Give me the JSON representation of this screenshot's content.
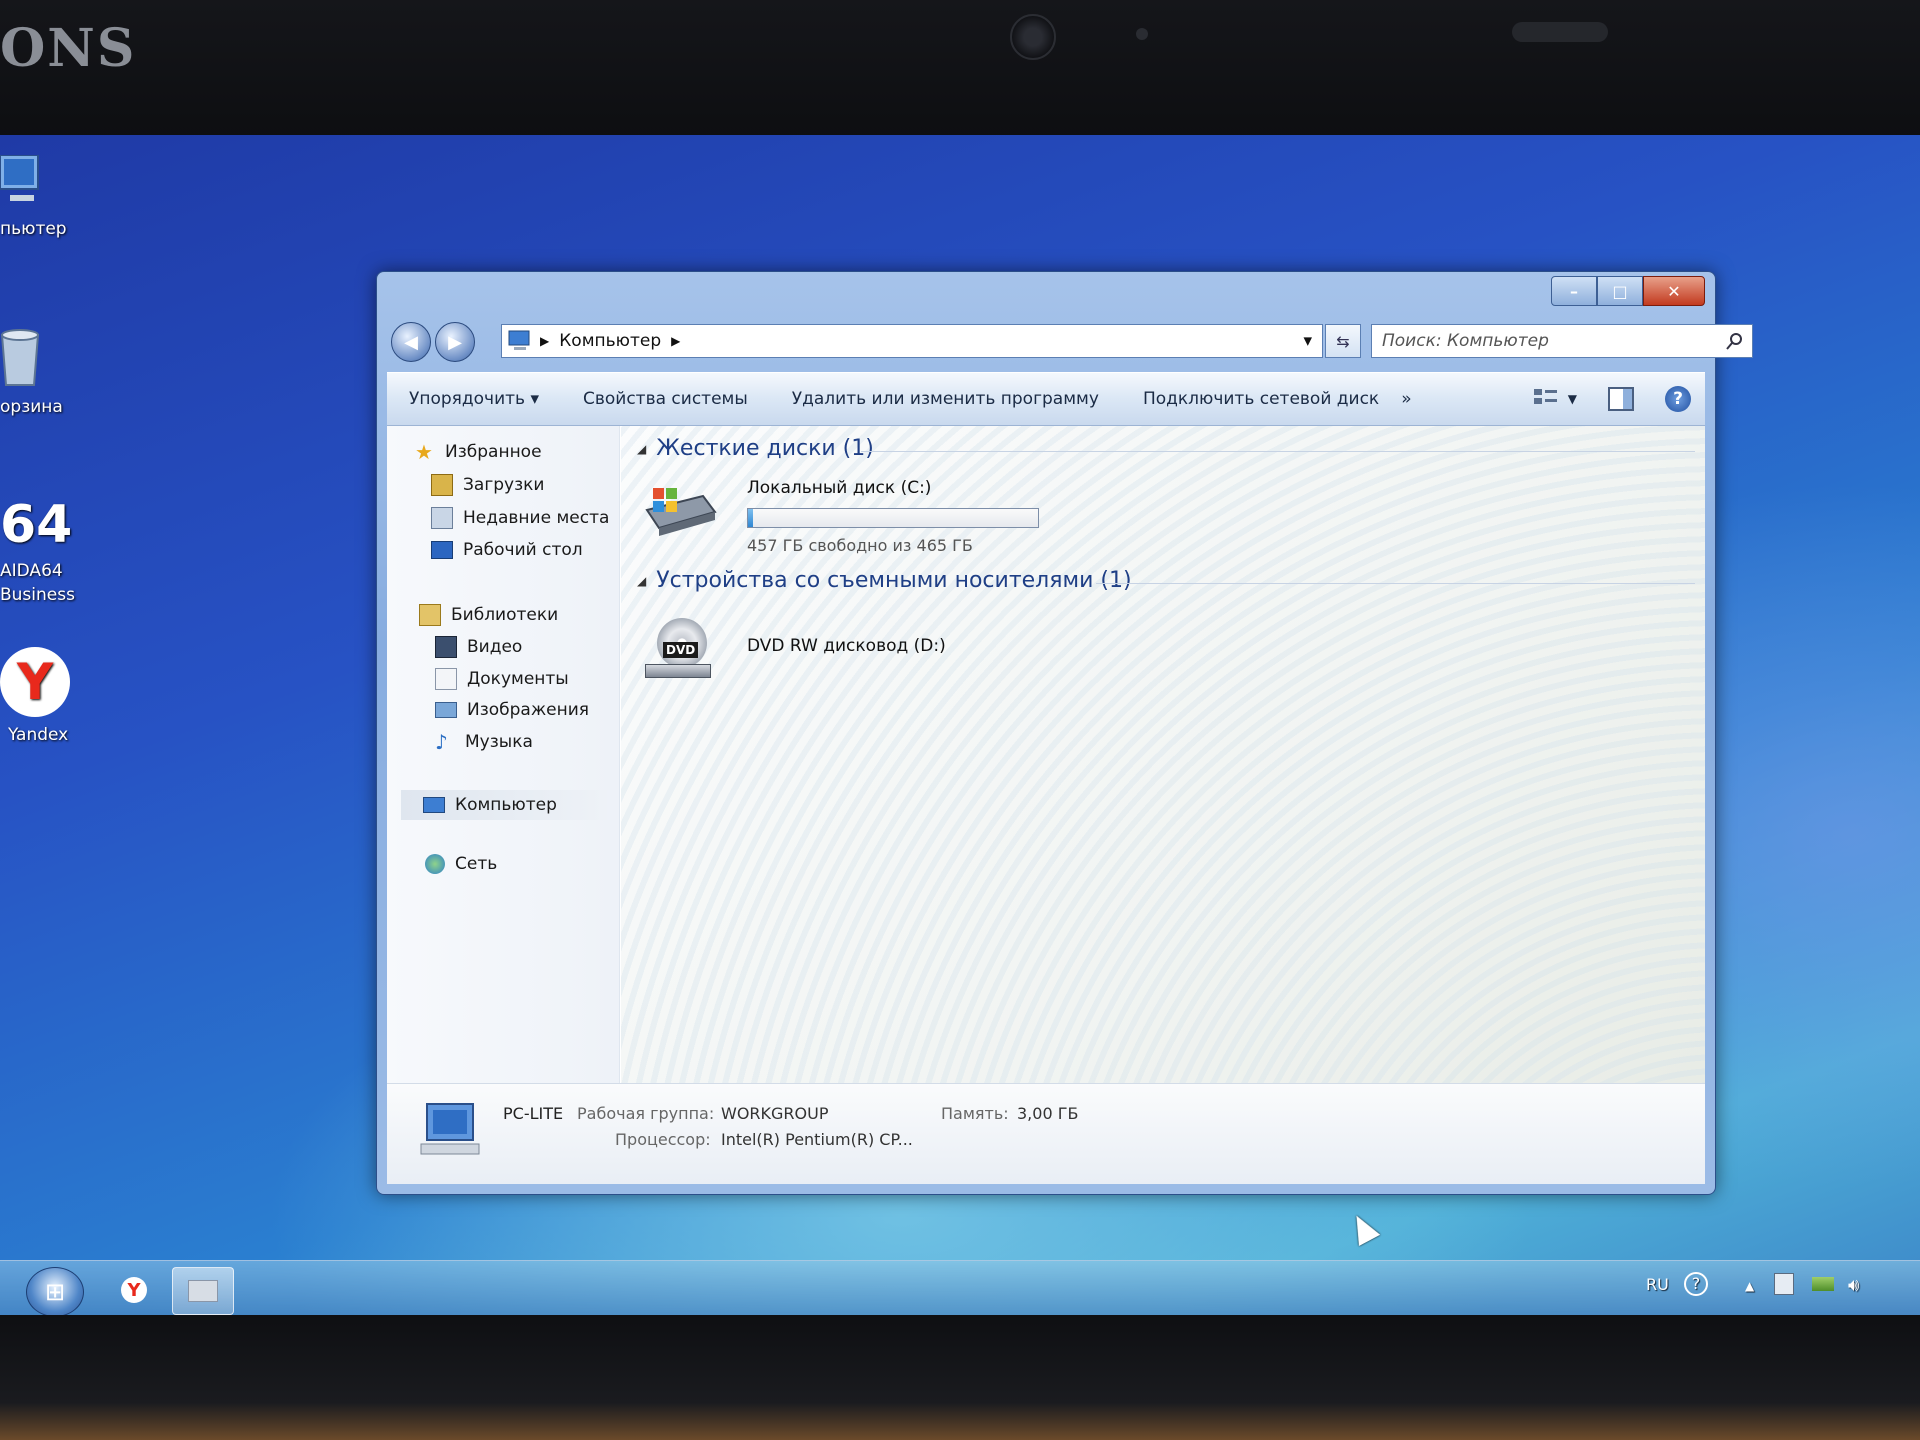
{
  "bezel": {
    "brand": "ONS"
  },
  "desktop": {
    "icons": [
      {
        "label": "пьютер",
        "icon": "computer-icon"
      },
      {
        "label": "орзина",
        "icon": "recycle-bin-icon"
      },
      {
        "label_line1": "AIDA64",
        "label_line2": "Business",
        "badge": "64",
        "icon": "aida64-icon"
      },
      {
        "label": "Yandex",
        "glyph": "Y",
        "icon": "yandex-icon"
      }
    ]
  },
  "window": {
    "caption": {
      "minimize": "–",
      "maximize": "□",
      "close": "✕"
    },
    "nav": {
      "back": "◀",
      "forward": "▶"
    },
    "address": {
      "separator": "▶",
      "path_item": "Компьютер",
      "dropdown": "▾",
      "refresh": "⇆"
    },
    "search": {
      "placeholder": "Поиск: Компьютер",
      "icon": "magnifier-icon"
    },
    "toolbar": {
      "organize": "Упорядочить ▾",
      "system_properties": "Свойства системы",
      "uninstall": "Удалить или изменить программу",
      "map_drive": "Подключить сетевой диск",
      "more": "»",
      "help": "?"
    },
    "nav_pane": {
      "favorites": "Избранное",
      "downloads": "Загрузки",
      "recent": "Недавние места",
      "desktop": "Рабочий стол",
      "libraries": "Библиотеки",
      "video": "Видео",
      "documents": "Документы",
      "pictures": "Изображения",
      "music": "Музыка",
      "computer": "Компьютер",
      "network": "Сеть"
    },
    "content": {
      "hard_drives_header": "Жесткие диски (1)",
      "drive_c": {
        "name": "Локальный диск (C:)",
        "free_text": "457 ГБ свободно из 465 ГБ",
        "used_fraction": 0.017
      },
      "removable_header": "Устройства со съемными носителями (1)",
      "drive_d": {
        "name": "DVD RW дисковод (D:)",
        "badge": "DVD"
      }
    },
    "details": {
      "computer_name": "PC-LITE",
      "workgroup_label": "Рабочая группа:",
      "workgroup_value": "WORKGROUP",
      "memory_label": "Память:",
      "memory_value": "3,00 ГБ",
      "cpu_label": "Процессор:",
      "cpu_value": "Intel(R) Pentium(R) CP..."
    }
  },
  "taskbar": {
    "start_glyph": "⊞",
    "yandex_glyph": "Y",
    "language": "RU",
    "help": "?",
    "show_hidden": "▲"
  }
}
